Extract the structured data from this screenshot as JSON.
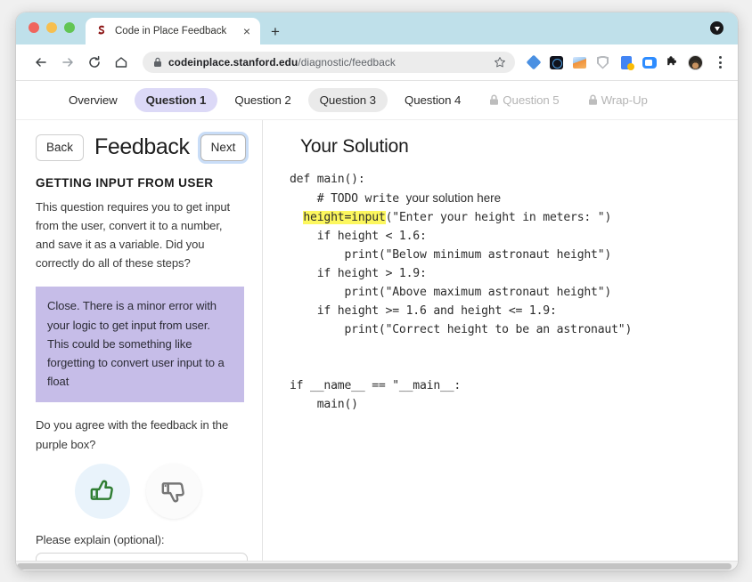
{
  "browser": {
    "tab": {
      "favicon": "stanford-s-icon",
      "title": "Code in Place Feedback",
      "close_label": "×"
    },
    "new_tab_label": "+",
    "toolbar": {
      "back_icon": "back-arrow-icon",
      "forward_icon": "forward-arrow-icon",
      "reload_icon": "reload-icon",
      "home_icon": "home-icon",
      "lock_icon": "padlock-icon",
      "url_bold": "codeinplace.stanford.edu",
      "url_rest": "/diagnostic/feedback",
      "star_icon": "bookmark-star-icon",
      "extensions": [
        "diamond-extension-icon",
        "dark-square-extension-icon",
        "photo-extension-icon",
        "shield-extension-icon",
        "docs-extension-icon",
        "zoom-extension-icon",
        "puzzle-extensions-icon"
      ],
      "avatar": "profile-avatar",
      "menu_icon": "kebab-menu-icon"
    }
  },
  "nav": {
    "tabs": [
      {
        "label": "Overview",
        "state": "normal"
      },
      {
        "label": "Question 1",
        "state": "active"
      },
      {
        "label": "Question 2",
        "state": "normal"
      },
      {
        "label": "Question 3",
        "state": "hover"
      },
      {
        "label": "Question 4",
        "state": "normal"
      },
      {
        "label": "Question 5",
        "state": "locked"
      },
      {
        "label": "Wrap-Up",
        "state": "locked"
      }
    ]
  },
  "sidebar": {
    "back_label": "Back",
    "title": "Feedback",
    "next_label": "Next",
    "question_heading": "GETTING INPUT FROM USER",
    "question_body": "This question requires you to get input from the user, convert it to a number, and save it as a variable. Did you correctly do all of these steps?",
    "feedback_text": "Close. There is a minor error with your logic to get input from user. This could be something like forgetting to convert user input to a float",
    "feedback_box_color": "#c6bde8",
    "agree_question": "Do you agree with the feedback in the purple box?",
    "thumbs_up_icon": "thumbs-up-icon",
    "thumbs_down_icon": "thumbs-down-icon",
    "thumbs_up_color": "#2f7d32",
    "thumbs_down_color": "#757575",
    "explain_label": "Please explain (optional):",
    "explain_value": "",
    "explain_placeholder": ""
  },
  "solution": {
    "title": "Your Solution",
    "highlight_color": "#fcf75e",
    "code_lines": [
      {
        "text": "def main():"
      },
      {
        "text": "    # TODO write ",
        "handwritten_suffix": "your solution here"
      },
      {
        "indent": "  ",
        "highlight": "height=input",
        "text": "(\"Enter your height in meters: \")"
      },
      {
        "text": "    if height < 1.6:"
      },
      {
        "text": "        print(\"Below minimum astronaut height\")"
      },
      {
        "text": "    if height > 1.9:"
      },
      {
        "text": "        print(\"Above maximum astronaut height\")"
      },
      {
        "text": "    if height >= 1.6 and height <= 1.9:"
      },
      {
        "text": "        print(\"Correct height to be an astronaut\")"
      },
      {
        "text": ""
      },
      {
        "text": ""
      },
      {
        "text": "if __name__ == \"__main__:"
      },
      {
        "text": "    main()"
      }
    ]
  }
}
